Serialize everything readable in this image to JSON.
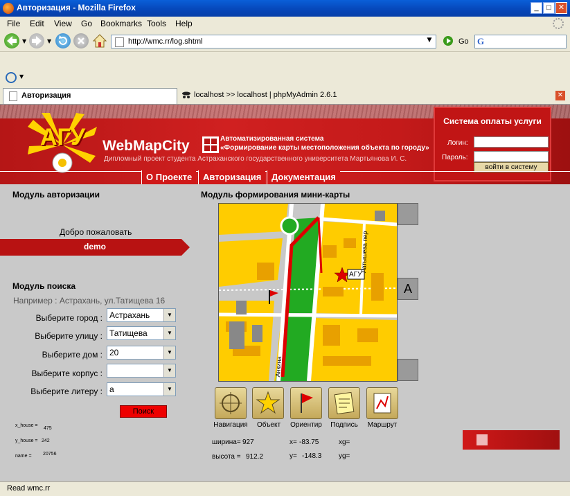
{
  "window": {
    "title": "Авторизация - Mozilla Firefox"
  },
  "menu": [
    "File",
    "Edit",
    "View",
    "Go",
    "Bookmarks",
    "Tools",
    "Help"
  ],
  "address": {
    "url": "http://wmc.rr/log.shtml",
    "go_label": "Go"
  },
  "tabs": [
    {
      "label": "Авторизация"
    },
    {
      "label": "localhost >> localhost | phpMyAdmin 2.6.1"
    }
  ],
  "header": {
    "logo_text": "АГУ",
    "site_name": "WebMapCity",
    "system_line1": "Автоматизированная система",
    "system_line2": "«Формирование карты местоположения объекта по городу»",
    "diploma": "Дипломный проект студента Астраханского государственного университета Мартьянова И. С."
  },
  "login": {
    "title": "Система оплаты услуги",
    "login_label": "Логин:",
    "password_label": "Пароль:",
    "login_value": "",
    "password_value": "",
    "submit_label": "войти в систему"
  },
  "nav": [
    "О Проекте",
    "Авторизация",
    "Документация"
  ],
  "auth": {
    "title": "Модуль авторизации",
    "welcome": "Добро пожаловать",
    "user": "demo"
  },
  "search": {
    "title": "Модуль поиска",
    "example": "Например : Астрахань, ул.Татищева 16",
    "fields": [
      {
        "label": "Выберите город :",
        "value": "Астрахань"
      },
      {
        "label": "Выберите улицу :",
        "value": "Татищева"
      },
      {
        "label": "Выберите дом :",
        "value": "20"
      },
      {
        "label": "Выберите корпус :",
        "value": ""
      },
      {
        "label": "Выберите литеру :",
        "value": "а"
      }
    ],
    "button": "Поиск",
    "debug": [
      {
        "label": "x_house =",
        "value": "475"
      },
      {
        "label": "y_house =",
        "value": "242"
      },
      {
        "label": "name =",
        "value": "20756"
      }
    ]
  },
  "map": {
    "title": "Модуль формирования мини-карты",
    "marker_label": "АГУ",
    "street_right": "Латышева пер",
    "street_left": "Анкина",
    "side_letter": "A",
    "colors": {
      "block": "#ffcc00",
      "park": "#22aa22",
      "road": "#ffffff",
      "route": "#dd0000",
      "building": "#e8a000"
    }
  },
  "tools": [
    "Навигация",
    "Объект",
    "Ориентир",
    "Подпись",
    "Маршрут"
  ],
  "info": {
    "width_label": "ширина=",
    "width_value": "927",
    "height_label": "высота =",
    "height_value": "912.2",
    "x_label": "x=",
    "x_value": "-83.75",
    "y_label": "y=",
    "y_value": "-148.3",
    "xg_label": "xg=",
    "yg_label": "yg="
  },
  "statusbar": {
    "text": "Read wmc.rr"
  }
}
